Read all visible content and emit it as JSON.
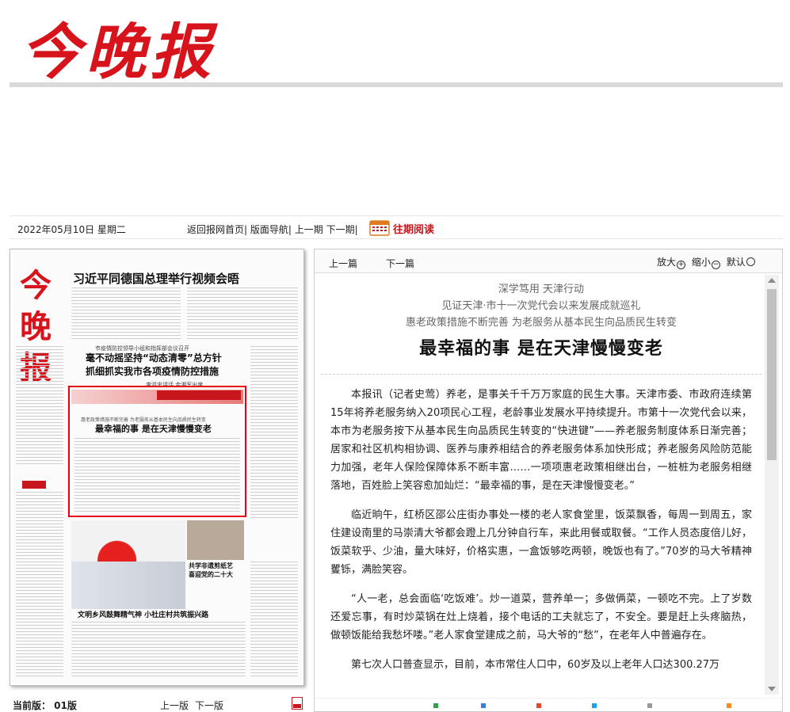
{
  "masthead": {
    "logo": "今晚报"
  },
  "toolbar": {
    "date": "2022年05月10日 星期二",
    "nav_home": "返回报网首页|",
    "nav_layout": "版面导航|",
    "nav_prev": "上一期",
    "nav_next": "下一期|",
    "archive": "往期阅读"
  },
  "paper": {
    "logo": "今晚报",
    "headline": "习近平同德国总理举行视频会晤",
    "sub1": "市疫情防控领导小组和指挥部会议召开",
    "head2_line1": "毫不动摇坚持“动态清零”总方针",
    "head2_line2": "抓细抓实我市各项疫情防控措施",
    "byline": "李鸿忠讲话 金湘军出席",
    "box_sub": "惠老政策措施不断完善 为老服务从基本民生向品质民生转变",
    "box_title": "最幸福的事 是在天津慢慢变老",
    "cap1_line1": "共学非遗剪纸艺",
    "cap1_line2": "喜迎党的二十大",
    "head3": "文明乡风鼓舞精气神 小社庄村共筑振兴路"
  },
  "bottom_left": {
    "current": "当前版： 01版",
    "prev": "上一版",
    "next": "下一版"
  },
  "article_bar": {
    "prev": "上一篇",
    "next": "下一篇",
    "zoom_in": "放大",
    "zoom_out": "缩小",
    "default": "默认"
  },
  "article": {
    "lead1": "深学笃用 天津行动",
    "lead2": "见证天津·市十一次党代会以来发展成就巡礼",
    "lead3": "惠老政策措施不断完善 为老服务从基本民生向品质民生转变",
    "title": "最幸福的事 是在天津慢慢变老",
    "p1": "本报讯（记者史莺）养老，是事关千千万万家庭的民生大事。天津市委、市政府连续第15年将养老服务纳入20项民心工程，老龄事业发展水平持续提升。市第十一次党代会以来，本市为老服务按下从基本民生向品质民生转变的“快进键”——养老服务制度体系日渐完善；居家和社区机构相协调、医养与康养相结合的养老服务体系加快形成；养老服务风险防范能力加强，老年人保险保障体系不断丰富……一项项惠老政策相继出台，一桩桩为老服务相继落地，百姓脸上笑容愈加灿烂：“最幸福的事，是在天津慢慢变老。”",
    "p2": "临近晌午，红桥区邵公庄街办事处一楼的老人家食堂里，饭菜飘香，每周一到周五，家住建设南里的马崇清大爷都会蹬上几分钟自行车，来此用餐或取餐。“工作人员态度倍儿好，饭菜软乎、少油，量大味好，价格实惠，一盒饭够吃两顿，晚饭也有了。”70岁的马大爷精神矍铄，满脸笑容。",
    "p3": "“人一老，总会面临‘吃饭难’。炒一道菜，营养单一；多做俩菜，一顿吃不完。上了岁数还爱忘事，有时炒菜锅在灶上烧着，接个电话的工夫就忘了，不安全。要是赶上头疼脑热，做顿饭能给我愁坏喽。”老人家食堂建成之前，马大爷的“愁”，在老年人中普遍存在。",
    "p4": "第七次人口普查显示，目前，本市常住人口中，60岁及以上老年人口达300.27万"
  }
}
